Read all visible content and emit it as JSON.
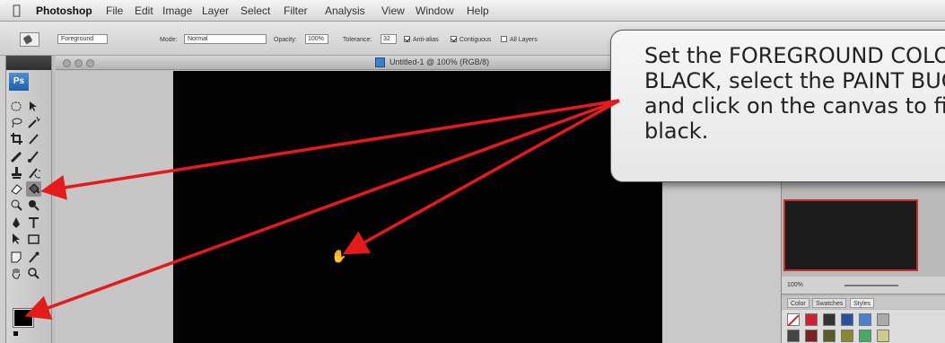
{
  "menubar": {
    "app_name": "Photoshop",
    "items": [
      "File",
      "Edit",
      "Image",
      "Layer",
      "Select",
      "Filter",
      "Analysis",
      "View",
      "Window",
      "Help"
    ]
  },
  "options_bar": {
    "fill_source": "Foreground",
    "mode_label": "Mode:",
    "mode_value": "Normal",
    "opacity_label": "Opacity:",
    "opacity_value": "100%",
    "tolerance_label": "Tolerance:",
    "tolerance_value": "32",
    "anti_alias_label": "Anti-alias",
    "anti_alias_checked": true,
    "contiguous_label": "Contiguous",
    "contiguous_checked": true,
    "all_layers_label": "All Layers",
    "all_layers_checked": false
  },
  "tools_panel": {
    "logo": "Ps",
    "selected_tool": "paint-bucket",
    "foreground_color": "#000000"
  },
  "document": {
    "title": "Untitled-1 @ 100% (RGB/8)",
    "canvas_color": "#030303"
  },
  "panels": {
    "navigator_zoom": "100%",
    "tabs": [
      "Color",
      "Swatches",
      "Styles"
    ]
  },
  "callout": {
    "text": "Set the FOREGROUND COLOUR to\nBLACK, select the PAINT BUCKET\nand click on the canvas to fill it in\nblack."
  },
  "annotation_color": "#e41b1b"
}
